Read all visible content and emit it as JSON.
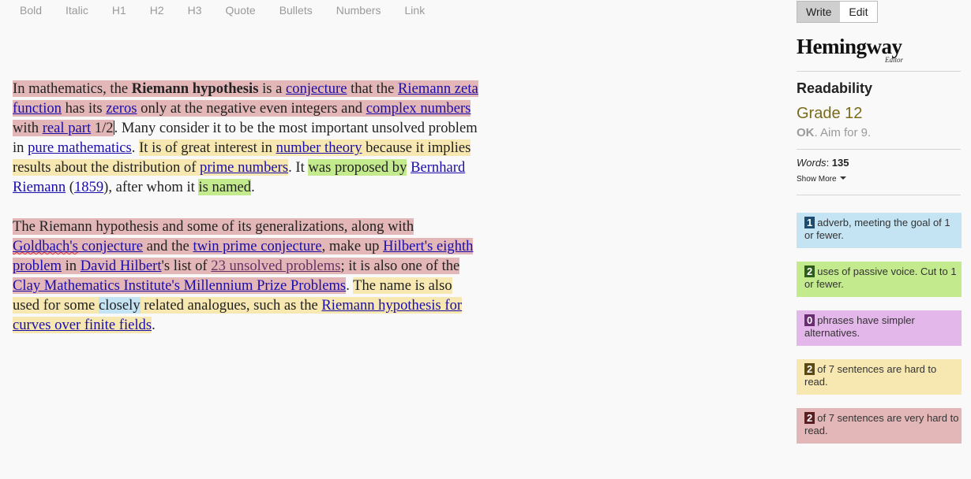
{
  "toolbar": [
    "Bold",
    "Italic",
    "H1",
    "H2",
    "H3",
    "Quote",
    "Bullets",
    "Numbers",
    "Link"
  ],
  "mode": {
    "write": "Write",
    "edit": "Edit"
  },
  "logo": {
    "name": "Hemingway",
    "sub": "Editor"
  },
  "readability": {
    "title": "Readability",
    "grade": "Grade 12",
    "status": "OK",
    "aim": ". Aim for 9.",
    "words_label": "Words",
    "words_sep": ": ",
    "words_count": "135",
    "show_more": "Show More"
  },
  "cards": [
    {
      "count": "1",
      "text": "adverb, meeting the goal of 1 or fewer.",
      "bg": "#c4e3f3",
      "badge": "#1e4c6e"
    },
    {
      "count": "2",
      "text": "uses of passive voice. Cut to 1 or fewer.",
      "bg": "#c4ea8e",
      "badge": "#2c5d1a"
    },
    {
      "count": "0",
      "text": "phrases have simpler alternatives.",
      "bg": "#e3b7e9",
      "badge": "#6a2c70"
    },
    {
      "count": "2",
      "text": "of 7 sentences are hard to read.",
      "bg": "#f7e8b1",
      "badge": "#5a4a12"
    },
    {
      "count": "2",
      "text": "of 7 sentences are very hard to read.",
      "bg": "#e3b7b7",
      "badge": "#5a1e1e"
    }
  ],
  "p1": {
    "s1a": "In mathematics, the ",
    "s1b": "Riemann hypothesis",
    "s1c": " is a ",
    "s1d": "conjecture",
    "s1e": " that the ",
    "s1f": "Riemann zeta function",
    "s1g": " has its ",
    "s1h": "zeros",
    "s1i": " only at the negative even integers and ",
    "s1j": "complex numbers",
    "s1k": " with ",
    "s1l": "real part",
    "s1m": " 1/2",
    "s2a": ". Many consider it to be the most important unsolved problem in ",
    "s2b": "pure mathematics",
    "s2c": ". ",
    "s3a": "It is of great interest in ",
    "s3b": "number theory",
    "s3c": " because it implies results about the distribution of ",
    "s3d": "prime numbers",
    "s4a": ". It ",
    "s4b": "was proposed by",
    "s4c": " ",
    "s4d": "Bernhard Riemann",
    "s4e": " (",
    "s4f": "1859",
    "s4g": "), after whom it ",
    "s4h": "is named",
    "s4i": "."
  },
  "p2": {
    "s1a": "The Riemann hypothesis and some of its generalizations, along with ",
    "s1b": "Goldbach's",
    "s1c": " conjecture",
    "s1d": " and the ",
    "s1e": "twin prime conjecture",
    "s1f": ", make up ",
    "s1g": "Hilbert's eighth problem",
    "s1h": " in ",
    "s1i": "David Hilbert",
    "s1j": "'s list of ",
    "s1k": "23 unsolved problems",
    "s1l": "; it is also one of the ",
    "s1m": "Clay Mathematics Institute's Millennium Prize Problems",
    "s2a": ". ",
    "s2b": "The name is also used for some ",
    "s2c": "closely",
    "s2d": " related analogues, such as the ",
    "s2e": "Riemann hypothesis for curves over finite fields",
    "s2f": "."
  }
}
